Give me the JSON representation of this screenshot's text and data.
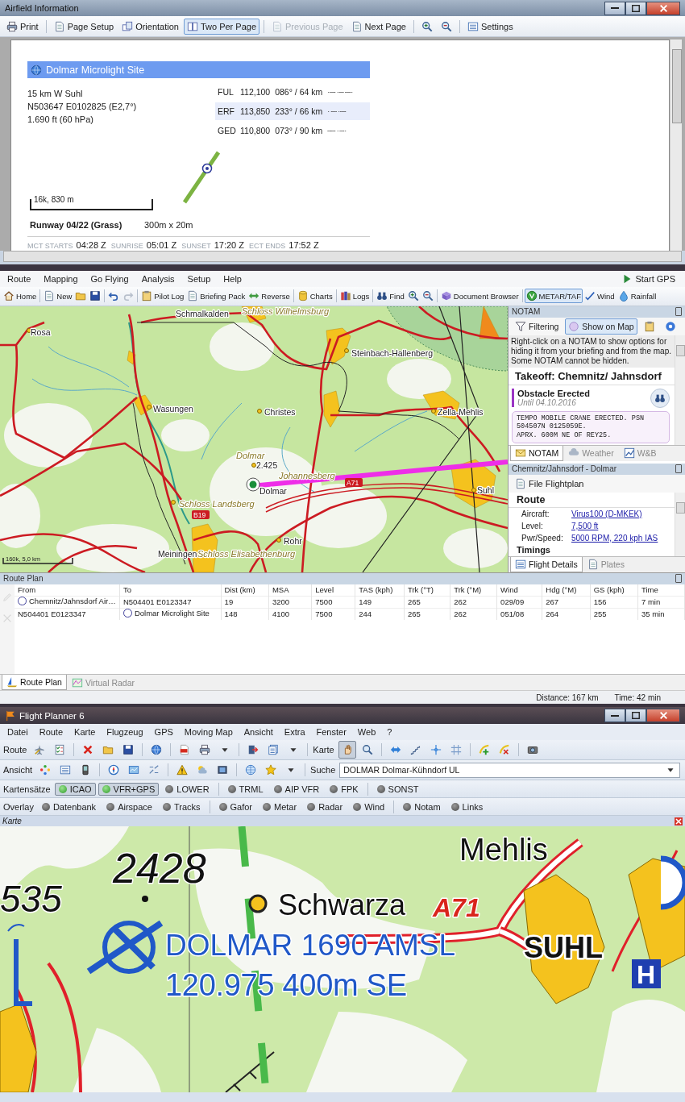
{
  "airfield_window": {
    "title": "Airfield Information",
    "toolbar": [
      {
        "label": "Print",
        "selected": false,
        "disabled": false
      },
      {
        "label": "Page Setup",
        "selected": false,
        "disabled": false
      },
      {
        "label": "Orientation",
        "selected": false,
        "disabled": false
      },
      {
        "label": "Two Per Page",
        "selected": true,
        "disabled": false
      },
      {
        "label": "Previous Page",
        "selected": false,
        "disabled": true
      },
      {
        "label": "Next Page",
        "selected": false,
        "disabled": false
      },
      {
        "label": "Settings",
        "selected": false,
        "disabled": false
      }
    ],
    "page": {
      "title": "Dolmar Microlight Site",
      "details": [
        "15 km W Suhl",
        "N503647 E0102825 (E2,7°)",
        "1.690 ft (60 hPa)"
      ],
      "navaids": [
        {
          "id": "FUL",
          "frequency": "112,100",
          "bearing": "086° / 64 km",
          "morse": "··–· ··– ·–··",
          "selected": false
        },
        {
          "id": "ERF",
          "frequency": "113,850",
          "bearing": "233° / 66 km",
          "morse": "· ·–· ··–·",
          "selected": true
        },
        {
          "id": "GED",
          "frequency": "110,800",
          "bearing": "073° / 90 km",
          "morse": "––· · –··",
          "selected": false
        }
      ],
      "scale": "16k, 830 m",
      "runway": {
        "name": "Runway 04/22 (Grass)",
        "size": "300m x 20m"
      },
      "times": [
        {
          "label": "MCT STARTS",
          "value": "04:28 Z"
        },
        {
          "label": "SUNRISE",
          "value": "05:01 Z"
        },
        {
          "label": "SUNSET",
          "value": "17:20 Z"
        },
        {
          "label": "ECT ENDS",
          "value": "17:52 Z"
        }
      ]
    }
  },
  "planner_window": {
    "menu": [
      "Route",
      "Mapping",
      "Go Flying",
      "Analysis",
      "Setup",
      "Help"
    ],
    "start_gps": "Start GPS",
    "toolbar": [
      {
        "label": "Home",
        "selected": false
      },
      {
        "label": "New",
        "selected": false
      },
      {
        "label": "Pilot Log",
        "selected": false
      },
      {
        "label": "Briefing Pack",
        "selected": false
      },
      {
        "label": "Reverse",
        "selected": false
      },
      {
        "label": "Charts",
        "selected": false
      },
      {
        "label": "Logs",
        "selected": false
      },
      {
        "label": "Find",
        "selected": false
      },
      {
        "label": "Document Browser",
        "selected": false
      },
      {
        "label": "METAR/TAF",
        "selected": true
      },
      {
        "label": "Wind",
        "selected": false
      },
      {
        "label": "Rainfall",
        "selected": false
      }
    ],
    "map": {
      "labels": [
        {
          "text": "Rosa",
          "kind": "town"
        },
        {
          "text": "Schmalkalden",
          "kind": "town"
        },
        {
          "text": "Schloss Wilhelmsburg",
          "kind": "feature"
        },
        {
          "text": "Steinbach-Hallenberg",
          "kind": "town"
        },
        {
          "text": "Wasungen",
          "kind": "town"
        },
        {
          "text": "Christes",
          "kind": "town"
        },
        {
          "text": "Zella-Mehlis",
          "kind": "town"
        },
        {
          "text": "Dolmar",
          "kind": "feature"
        },
        {
          "text": "2.425",
          "kind": "town"
        },
        {
          "text": "Johannesberg",
          "kind": "feature"
        },
        {
          "text": "Dolmar",
          "kind": "town"
        },
        {
          "text": "Schloss Landsberg",
          "kind": "feature"
        },
        {
          "text": "Rohr",
          "kind": "town"
        },
        {
          "text": "Meiningen",
          "kind": "town"
        },
        {
          "text": "Schloss Elisabethenburg",
          "kind": "feature"
        },
        {
          "text": "Suhl",
          "kind": "town"
        },
        {
          "text": "B19",
          "kind": "shield"
        },
        {
          "text": "A71",
          "kind": "shield"
        }
      ],
      "scale": "160k, 5,0 km"
    },
    "notam": {
      "title": "NOTAM",
      "tools": [
        {
          "label": "Filtering",
          "selected": false
        },
        {
          "label": "Show on Map",
          "selected": true
        }
      ],
      "info": "Right-click on a NOTAM to show options for hiding it from your briefing and from the map. Some NOTAM cannot be hidden.",
      "heading": "Takeoff: Chemnitz/ Jahnsdorf",
      "item": {
        "title": "Obstacle Erected",
        "until": "Until 04.10.2016",
        "text": [
          "TEMPO MOBILE CRANE ERECTED. PSN",
          "504507N 0125059E.",
          "APRX. 600M NE OF REY25."
        ]
      },
      "tabs": [
        {
          "label": "NOTAM",
          "selected": true
        },
        {
          "label": "Weather",
          "selected": false
        },
        {
          "label": "W&B",
          "selected": false
        }
      ]
    },
    "details": {
      "title": "Chemnitz/Jahnsdorf - Dolmar",
      "action": "File Flightplan",
      "section": "Route",
      "fields": [
        {
          "label": "Aircraft:",
          "value": "Virus100 (D-MKEK)"
        },
        {
          "label": "Level:",
          "value": "7,500 ft"
        },
        {
          "label": "Pwr/Speed:",
          "value": "5000 RPM, 220 kph IAS"
        }
      ],
      "next_section": "Timings",
      "tabs": [
        {
          "label": "Flight Details",
          "selected": true
        },
        {
          "label": "Plates",
          "selected": false
        }
      ]
    },
    "route_plan": {
      "title": "Route Plan",
      "columns": [
        "From",
        "To",
        "Dist (km)",
        "MSA",
        "Level",
        "TAS (kph)",
        "Trk (°T)",
        "Trk (°M)",
        "Wind",
        "Hdg (°M)",
        "GS (kph)",
        "Time"
      ],
      "rows": [
        {
          "from_airfield": true,
          "to_airfield": false,
          "cells": [
            "Chemnitz/Jahnsdorf Air…",
            "N504401 E0123347",
            "19",
            "3200",
            "7500",
            "149",
            "265",
            "262",
            "029/09",
            "267",
            "156",
            "7 min"
          ]
        },
        {
          "from_airfield": false,
          "to_airfield": true,
          "cells": [
            "N504401 E0123347",
            "Dolmar Microlight Site",
            "148",
            "4100",
            "7500",
            "244",
            "265",
            "262",
            "051/08",
            "264",
            "255",
            "35 min"
          ]
        }
      ],
      "tabs": [
        {
          "label": "Route Plan",
          "selected": true
        },
        {
          "label": "Virtual Radar",
          "selected": false
        }
      ]
    },
    "status": [
      "Distance: 167 km",
      "Time: 42 min"
    ]
  },
  "fp6_window": {
    "title": "Flight Planner 6",
    "menu": [
      "Datei",
      "Route",
      "Karte",
      "Flugzeug",
      "GPS",
      "Moving Map",
      "Ansicht",
      "Extra",
      "Fenster",
      "Web",
      "?"
    ],
    "route_label": "Route",
    "karte_label": "Karte",
    "ansicht_label": "Ansicht",
    "search_label": "Suche",
    "karte_tools": [
      {
        "selected": true
      },
      {
        "selected": false
      }
    ],
    "search_value": "DOLMAR Dolmar-Kühndorf UL",
    "chart_sets": {
      "label": "Kartensätze",
      "items": [
        {
          "label": "ICAO",
          "on": true
        },
        {
          "label": "VFR+GPS",
          "on": true
        },
        {
          "label": "LOWER",
          "on": false
        },
        {
          "label": "TRML",
          "on": false
        },
        {
          "label": "AIP VFR",
          "on": false
        },
        {
          "label": "FPK",
          "on": false
        },
        {
          "label": "SONST",
          "on": false
        }
      ]
    },
    "overlay": {
      "label": "Overlay",
      "items": [
        {
          "label": "Datenbank",
          "on": false
        },
        {
          "label": "Airspace",
          "on": false
        },
        {
          "label": "Tracks",
          "on": false
        },
        {
          "label": "Gafor",
          "on": false
        },
        {
          "label": "Metar",
          "on": false
        },
        {
          "label": "Radar",
          "on": false
        },
        {
          "label": "Wind",
          "on": false
        },
        {
          "label": "Notam",
          "on": false
        },
        {
          "label": "Links",
          "on": false
        }
      ]
    },
    "map_panel": {
      "title": "Karte",
      "labels": [
        {
          "text": "2428",
          "kind": "place"
        },
        {
          "text": "535",
          "kind": "place"
        },
        {
          "text": "Mehlis",
          "kind": "place"
        },
        {
          "text": "Schwarza",
          "kind": "place"
        },
        {
          "text": "A71",
          "kind": "road"
        },
        {
          "text": "DOLMAR 1690 AMSL",
          "kind": "airfield"
        },
        {
          "text": "120.975 400m SE",
          "kind": "airfield"
        },
        {
          "text": "SUHL",
          "kind": "city"
        },
        {
          "text": "H",
          "kind": "symbol"
        }
      ]
    }
  }
}
